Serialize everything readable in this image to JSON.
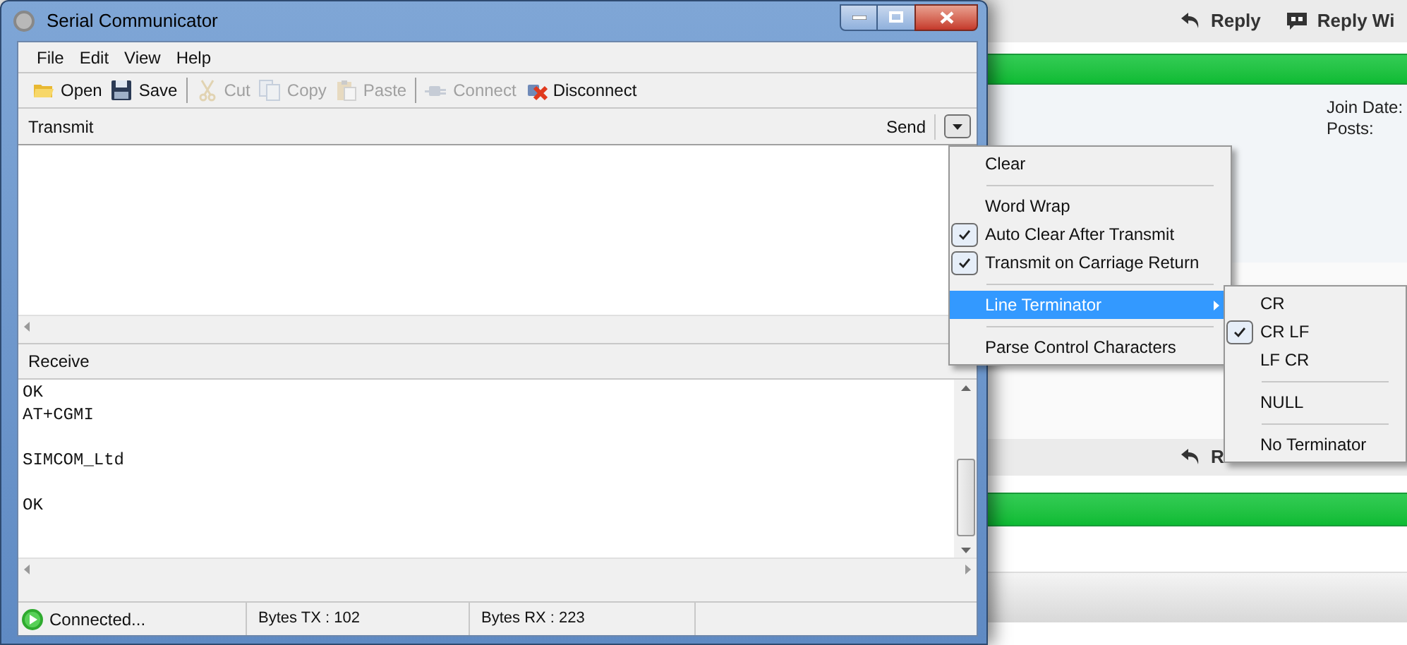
{
  "background_page": {
    "top_actions": [
      {
        "label": "Reply",
        "kind": "reply"
      },
      {
        "label": "Reply Wi",
        "kind": "quote"
      }
    ],
    "profile_labels": [
      "Join Date:",
      "Posts:"
    ],
    "bottom_actions": [
      {
        "label": "R",
        "kind": "reply"
      }
    ]
  },
  "window": {
    "title": "Serial Communicator",
    "menu": [
      "File",
      "Edit",
      "View",
      "Help"
    ],
    "toolbar": [
      {
        "label": "Open",
        "kind": "folder",
        "disabled": false
      },
      {
        "label": "Save",
        "kind": "disk",
        "disabled": false
      },
      {
        "label": "Cut",
        "kind": "scissors",
        "disabled": true
      },
      {
        "label": "Copy",
        "kind": "copy",
        "disabled": true
      },
      {
        "label": "Paste",
        "kind": "paste",
        "disabled": true
      },
      {
        "label": "Connect",
        "kind": "plug",
        "disabled": true
      },
      {
        "label": "Disconnect",
        "kind": "unplug",
        "disabled": false
      }
    ],
    "transmit": {
      "title": "Transmit",
      "send": "Send"
    },
    "receive": {
      "title": "Receive",
      "text": "OK\nAT+CGMI\n\nSIMCOM_Ltd\n\nOK"
    },
    "status": {
      "connection": "Connected...",
      "bytes_tx": "Bytes TX : 102",
      "bytes_rx": "Bytes RX : 223"
    }
  },
  "send_menu": [
    {
      "kind": "item",
      "label": "Clear",
      "checked": false,
      "selected": false
    },
    {
      "kind": "separator"
    },
    {
      "kind": "item",
      "label": "Word Wrap",
      "checked": false,
      "selected": false
    },
    {
      "kind": "item",
      "label": "Auto Clear After Transmit",
      "checked": true,
      "selected": false
    },
    {
      "kind": "item",
      "label": "Transmit on Carriage Return",
      "checked": true,
      "selected": false
    },
    {
      "kind": "separator"
    },
    {
      "kind": "submenu",
      "label": "Line Terminator",
      "checked": false,
      "selected": true
    },
    {
      "kind": "separator"
    },
    {
      "kind": "item",
      "label": "Parse Control Characters",
      "checked": false,
      "selected": false
    }
  ],
  "line_terminator_menu": [
    {
      "kind": "item",
      "label": "CR",
      "checked": false,
      "selected": false
    },
    {
      "kind": "item",
      "label": "CR LF",
      "checked": true,
      "selected": false
    },
    {
      "kind": "item",
      "label": "LF CR",
      "checked": false,
      "selected": false
    },
    {
      "kind": "separator"
    },
    {
      "kind": "item",
      "label": "NULL",
      "checked": false,
      "selected": false
    },
    {
      "kind": "separator"
    },
    {
      "kind": "item",
      "label": "No Terminator",
      "checked": false,
      "selected": false
    }
  ]
}
